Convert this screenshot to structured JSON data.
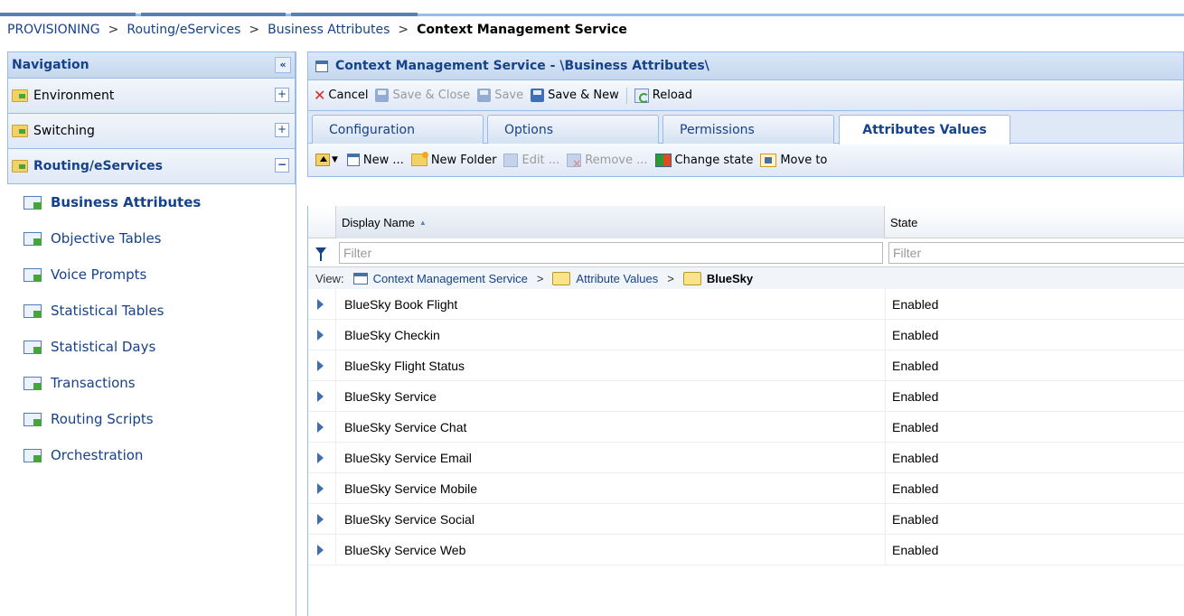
{
  "breadcrumb": {
    "items": [
      "PROVISIONING",
      "Routing/eServices",
      "Business Attributes"
    ],
    "separator": ">",
    "current": "Context Management Service"
  },
  "sidebar": {
    "title": "Navigation",
    "collapse_glyph": "«",
    "groups": [
      {
        "label": "Environment",
        "toggle": "+"
      },
      {
        "label": "Switching",
        "toggle": "+"
      },
      {
        "label": "Routing/eServices",
        "toggle": "−"
      }
    ],
    "items": [
      {
        "label": "Business Attributes"
      },
      {
        "label": "Objective Tables"
      },
      {
        "label": "Voice Prompts"
      },
      {
        "label": "Statistical Tables"
      },
      {
        "label": "Statistical Days"
      },
      {
        "label": "Transactions"
      },
      {
        "label": "Routing Scripts"
      },
      {
        "label": "Orchestration"
      }
    ]
  },
  "panel": {
    "title": "Context Management Service - \\Business Attributes\\"
  },
  "toolbar": {
    "cancel": "Cancel",
    "save_close": "Save & Close",
    "save": "Save",
    "save_new": "Save & New",
    "reload": "Reload"
  },
  "tabs": [
    {
      "label": "Configuration"
    },
    {
      "label": "Options"
    },
    {
      "label": "Permissions"
    },
    {
      "label": "Attributes Values"
    }
  ],
  "toolbar2": {
    "new": "New ...",
    "new_folder": "New Folder",
    "edit": "Edit ...",
    "remove": "Remove ...",
    "change_state": "Change state",
    "move_to": "Move to"
  },
  "grid": {
    "columns": [
      "Display Name",
      "State"
    ],
    "filter_placeholder": "Filter",
    "view": {
      "label": "View:",
      "path": [
        "Context Management Service",
        "Attribute Values",
        "BlueSky"
      ],
      "separator": ">"
    },
    "rows": [
      {
        "name": "BlueSky Book Flight",
        "state": "Enabled"
      },
      {
        "name": "BlueSky Checkin",
        "state": "Enabled"
      },
      {
        "name": "BlueSky Flight Status",
        "state": "Enabled"
      },
      {
        "name": "BlueSky Service",
        "state": "Enabled"
      },
      {
        "name": "BlueSky Service Chat",
        "state": "Enabled"
      },
      {
        "name": "BlueSky Service Email",
        "state": "Enabled"
      },
      {
        "name": "BlueSky Service Mobile",
        "state": "Enabled"
      },
      {
        "name": "BlueSky Service Social",
        "state": "Enabled"
      },
      {
        "name": "BlueSky Service Web",
        "state": "Enabled"
      }
    ]
  }
}
